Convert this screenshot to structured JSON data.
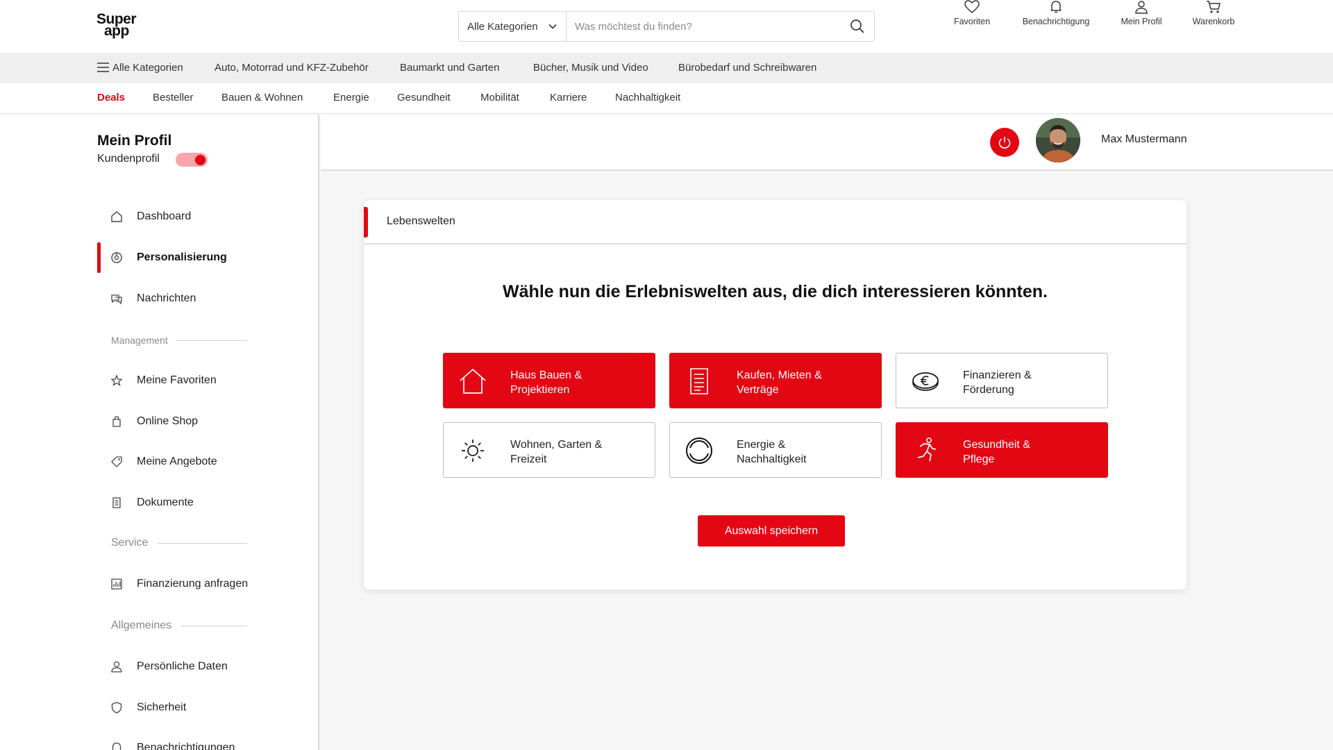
{
  "header": {
    "logo_line1": "Super",
    "logo_line2": "app",
    "search_category": "Alle Kategorien",
    "search_placeholder": "Was möchtest du finden?",
    "icons": [
      {
        "label": "Favoriten",
        "icon": "heart-icon"
      },
      {
        "label": "Benachrichtigung",
        "icon": "bell-icon"
      },
      {
        "label": "Mein Profil",
        "icon": "user-icon"
      },
      {
        "label": "Warenkorb",
        "icon": "cart-icon"
      }
    ]
  },
  "category_bar": {
    "all_label": "Alle Kategorien",
    "items": [
      "Auto, Motorrad und KFZ-Zubehör",
      "Baumarkt und Garten",
      "Bücher, Musik und Video",
      "Bürobedarf und Schreibwaren"
    ]
  },
  "sub_nav": {
    "items": [
      "Deals",
      "Besteller",
      "Bauen & Wohnen",
      "Energie",
      "Gesundheit",
      "Mobilität",
      "Karriere",
      "Nachhaltigkeit"
    ],
    "active": "Deals"
  },
  "sidebar": {
    "title": "Mein Profil",
    "subtitle": "Kundenprofil",
    "toggle_on": true,
    "items": [
      {
        "label": "Dashboard",
        "icon": "home-icon"
      },
      {
        "label": "Personalisierung",
        "icon": "personalization-icon",
        "active": true
      },
      {
        "label": "Nachrichten",
        "icon": "messages-icon"
      },
      {
        "label": "Meine Favoriten",
        "icon": "star-icon"
      },
      {
        "label": "Online Shop",
        "icon": "shopping-bag-icon"
      },
      {
        "label": "Meine Angebote",
        "icon": "tag-icon"
      },
      {
        "label": "Dokumente",
        "icon": "document-icon"
      },
      {
        "label": "Finanzierung anfragen",
        "icon": "chart-icon"
      },
      {
        "label": "Persönliche Daten",
        "icon": "user-icon"
      },
      {
        "label": "Sicherheit",
        "icon": "shield-icon"
      },
      {
        "label": "Benachrichtigungen",
        "icon": "bell-icon"
      }
    ],
    "sections": [
      "Management",
      "Service",
      "Allgemeines"
    ]
  },
  "user": {
    "name": "Max Mustermann"
  },
  "card": {
    "title": "Lebenswelten",
    "headline": "Wähle nun die Erlebniswelten aus, die dich interessieren könnten.",
    "tiles": [
      {
        "line1": "Haus Bauen &",
        "line2": "Projektieren",
        "icon": "house-icon",
        "selected": true
      },
      {
        "line1": "Kaufen, Mieten &",
        "line2": "Verträge",
        "icon": "contract-icon",
        "selected": true
      },
      {
        "line1": "Finanzieren &",
        "line2": "Förderung",
        "icon": "euro-coin-icon",
        "selected": false
      },
      {
        "line1": "Wohnen, Garten &",
        "line2": "Freizeit",
        "icon": "sun-icon",
        "selected": false
      },
      {
        "line1": "Energie &",
        "line2": "Nachhaltigkeit",
        "icon": "energy-cycle-icon",
        "selected": false
      },
      {
        "line1": "Gesundheit &",
        "line2": "Pflege",
        "icon": "runner-icon",
        "selected": true
      }
    ],
    "save_label": "Auswahl speichern"
  },
  "colors": {
    "accent": "#e30613",
    "toggle_track": "#f7a6ab",
    "category_bar_bg": "#efefef",
    "page_bg": "#f6f6f6"
  }
}
